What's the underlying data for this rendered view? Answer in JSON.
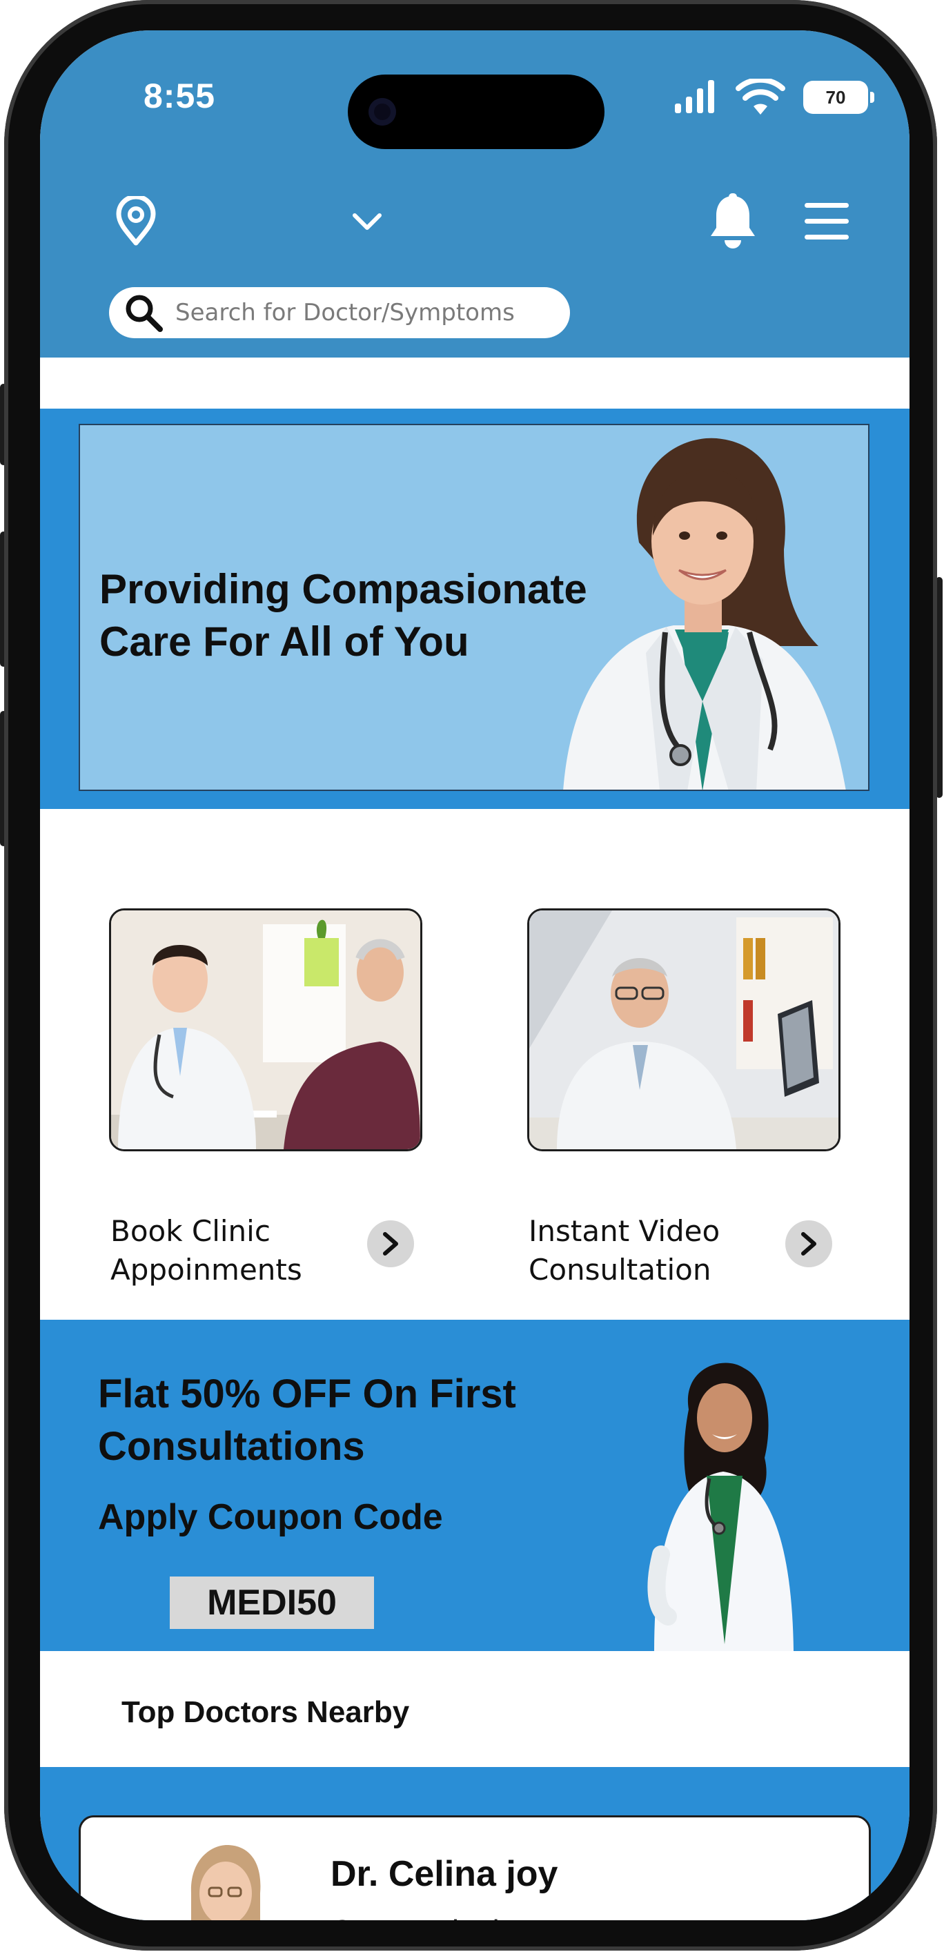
{
  "status_bar": {
    "time": "8:55",
    "battery": "70",
    "icons": [
      "signal-icon",
      "wifi-icon",
      "battery-icon"
    ]
  },
  "header": {
    "icons": [
      "location-pin-icon",
      "chevron-down-icon",
      "bell-icon",
      "menu-icon"
    ],
    "search": {
      "placeholder": "Search for Doctor/Symptoms",
      "icon": "search-icon"
    }
  },
  "hero": {
    "title": "Providing Compasionate Care For All of You"
  },
  "services": [
    {
      "label": "Book Clinic Appoinments",
      "icon": "chevron-right-icon"
    },
    {
      "label": "Instant Video Consultation",
      "icon": "chevron-right-icon"
    }
  ],
  "promo": {
    "title": "Flat 50% OFF On First Consultations",
    "subtitle": "Apply Coupon Code",
    "coupon_code": "MEDI50"
  },
  "top_doctors": {
    "title": "Top Doctors Nearby",
    "doctors": [
      {
        "name": "Dr. Celina joy",
        "specialty": "Cosmetologist"
      }
    ]
  },
  "colors": {
    "header_blue": "#3b8ec4",
    "section_blue": "#2a8ed6",
    "hero_light_blue": "#8fc6ea",
    "coupon_grey": "#d8d8d8"
  }
}
